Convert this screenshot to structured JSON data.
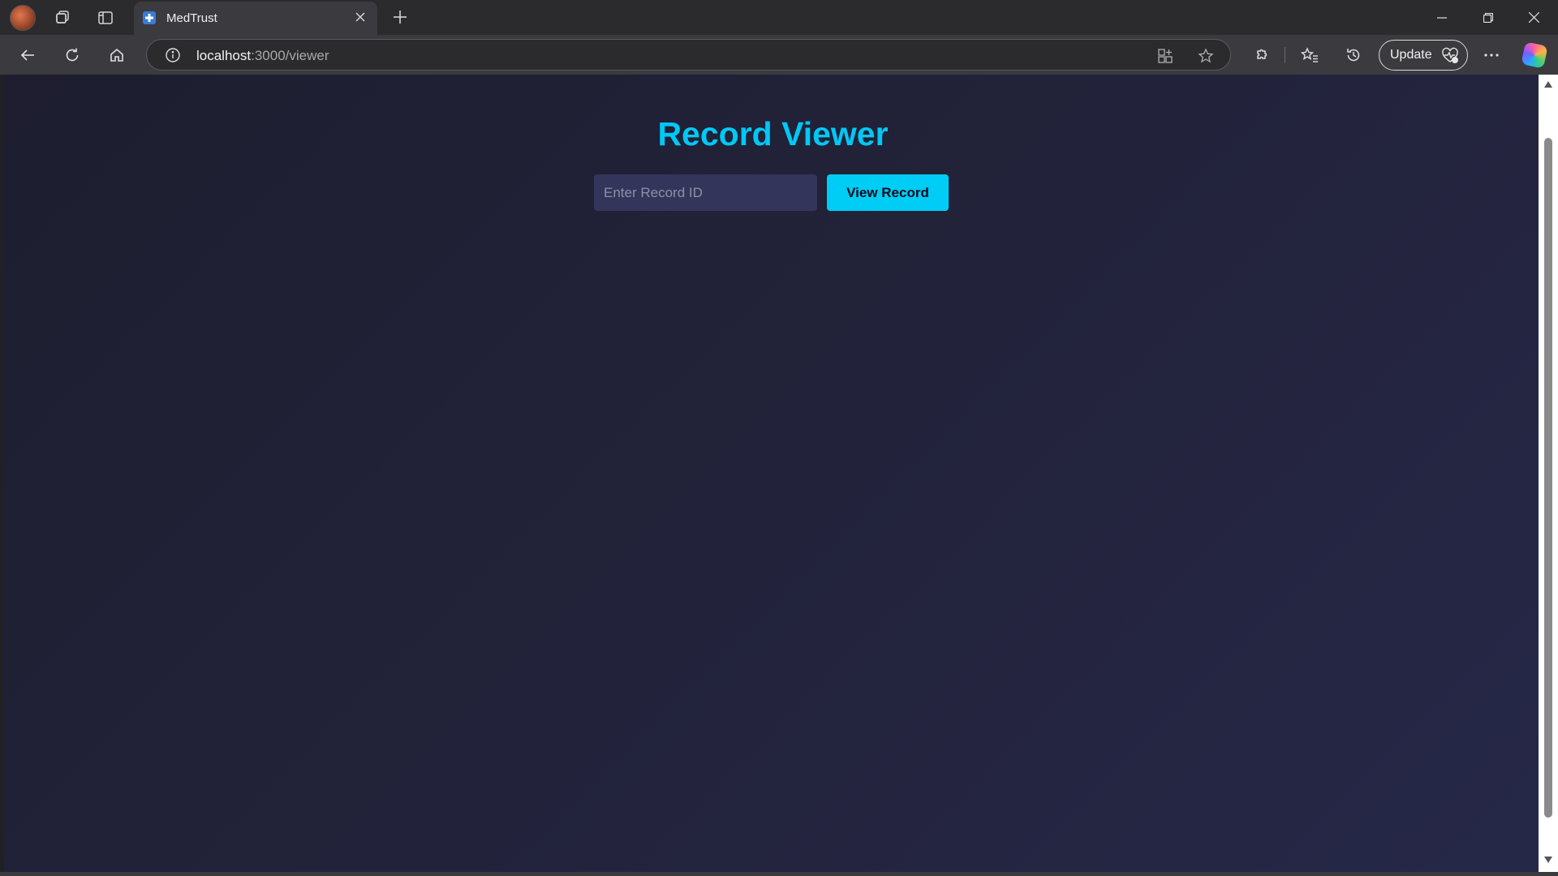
{
  "browser": {
    "tab": {
      "title": "MedTrust"
    },
    "address_bar": {
      "host": "localhost",
      "path": ":3000/viewer"
    },
    "update_label": "Update"
  },
  "page": {
    "title": "Record Viewer",
    "record_input": {
      "placeholder": "Enter Record ID",
      "value": ""
    },
    "view_button_label": "View Record"
  },
  "colors": {
    "accent": "#00c8f5",
    "page_bg": "#22223a",
    "input_bg": "#34355a"
  }
}
